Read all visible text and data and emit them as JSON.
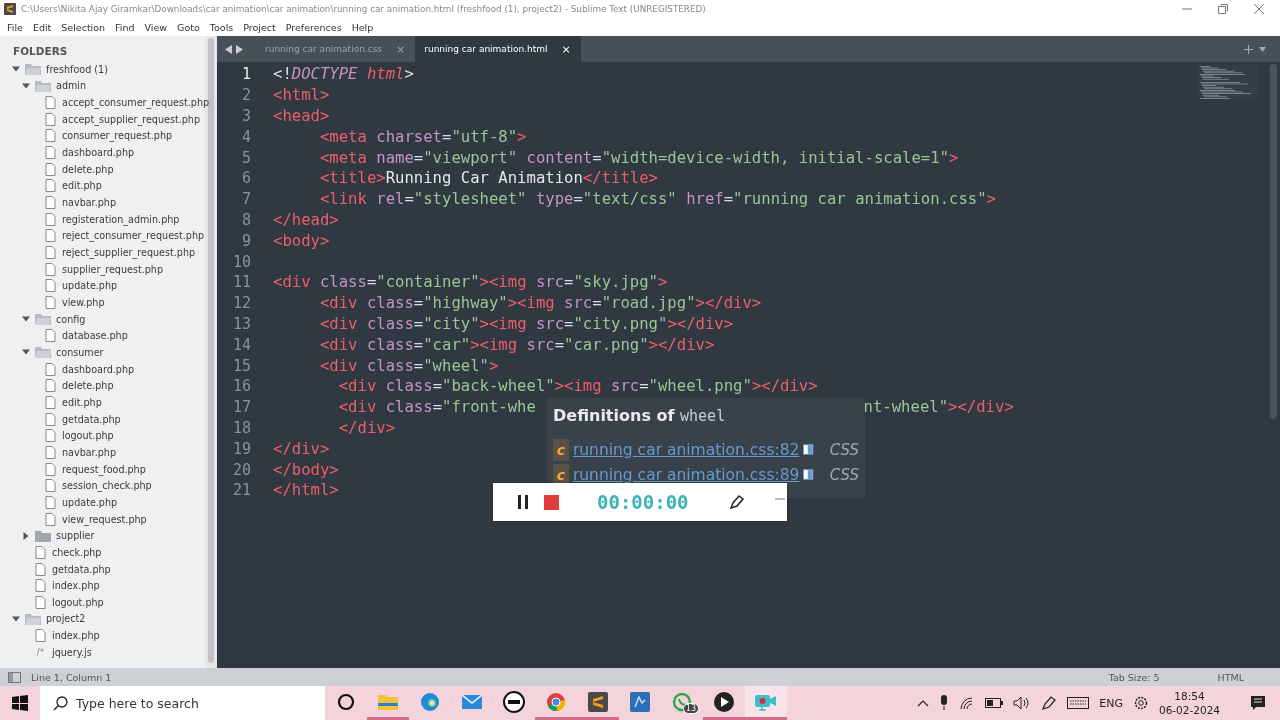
{
  "window": {
    "title": "C:\\Users\\Nikita Ajay Giramkar\\Downloads\\car animation\\car animation\\running car animation.html (freshfood (1), project2) - Sublime Text (UNREGISTERED)"
  },
  "menu": [
    "File",
    "Edit",
    "Selection",
    "Find",
    "View",
    "Goto",
    "Tools",
    "Project",
    "Preferences",
    "Help"
  ],
  "sidebar": {
    "heading": "FOLDERS",
    "tree": [
      {
        "kind": "folder",
        "name": "freshfood (1)",
        "expanded": true,
        "children": [
          {
            "kind": "folder",
            "name": "admin",
            "expanded": true,
            "children": [
              {
                "kind": "file",
                "name": "accept_consumer_request.php"
              },
              {
                "kind": "file",
                "name": "accept_supplier_request.php"
              },
              {
                "kind": "file",
                "name": "consumer_request.php"
              },
              {
                "kind": "file",
                "name": "dashboard.php"
              },
              {
                "kind": "file",
                "name": "delete.php"
              },
              {
                "kind": "file",
                "name": "edit.php"
              },
              {
                "kind": "file",
                "name": "navbar.php"
              },
              {
                "kind": "file",
                "name": "registeration_admin.php"
              },
              {
                "kind": "file",
                "name": "reject_consumer_request.php"
              },
              {
                "kind": "file",
                "name": "reject_supplier_request.php"
              },
              {
                "kind": "file",
                "name": "supplier_request.php"
              },
              {
                "kind": "file",
                "name": "update.php"
              },
              {
                "kind": "file",
                "name": "view.php"
              }
            ]
          },
          {
            "kind": "folder",
            "name": "config",
            "expanded": true,
            "children": [
              {
                "kind": "file",
                "name": "database.php"
              }
            ]
          },
          {
            "kind": "folder",
            "name": "consumer",
            "expanded": true,
            "children": [
              {
                "kind": "file",
                "name": "dashboard.php"
              },
              {
                "kind": "file",
                "name": "delete.php"
              },
              {
                "kind": "file",
                "name": "edit.php"
              },
              {
                "kind": "file",
                "name": "getdata.php"
              },
              {
                "kind": "file",
                "name": "logout.php"
              },
              {
                "kind": "file",
                "name": "navbar.php"
              },
              {
                "kind": "file",
                "name": "request_food.php"
              },
              {
                "kind": "file",
                "name": "session_check.php"
              },
              {
                "kind": "file",
                "name": "update.php"
              },
              {
                "kind": "file",
                "name": "view_request.php"
              }
            ]
          },
          {
            "kind": "folder",
            "name": "supplier",
            "expanded": false
          },
          {
            "kind": "file",
            "name": "check.php"
          },
          {
            "kind": "file",
            "name": "getdata.php"
          },
          {
            "kind": "file",
            "name": "index.php"
          },
          {
            "kind": "file",
            "name": "logout.php"
          }
        ]
      },
      {
        "kind": "folder",
        "name": "project2",
        "expanded": true,
        "children": [
          {
            "kind": "file",
            "name": "index.php"
          },
          {
            "kind": "script",
            "name": "jquery.js",
            "icon_text": "/*"
          }
        ]
      }
    ]
  },
  "tabs": [
    {
      "label": "running car animation.css",
      "selected": false,
      "close": "×"
    },
    {
      "label": "running car animation.html",
      "selected": true,
      "close": "×"
    }
  ],
  "code": {
    "lines": [
      {
        "number": "1",
        "current": true,
        "tokens": [
          {
            "kind": "punct",
            "text": "<!"
          },
          {
            "kind": "keyword",
            "text": "DOCTYPE"
          },
          {
            "kind": "doctype",
            "text": " html"
          },
          {
            "kind": "punct",
            "text": ">"
          }
        ]
      },
      {
        "number": "2",
        "current": false,
        "tokens": [
          {
            "kind": "tag",
            "text": "<html>"
          }
        ]
      },
      {
        "number": "3",
        "current": false,
        "tokens": [
          {
            "kind": "tag",
            "text": "<head>"
          }
        ]
      },
      {
        "number": "4",
        "current": false,
        "tokens": [
          {
            "kind": "tag",
            "text": "     <meta"
          },
          {
            "kind": "attr",
            "text": " charset"
          },
          {
            "kind": "punct",
            "text": "="
          },
          {
            "kind": "string",
            "text": "\"utf-8\""
          },
          {
            "kind": "tag",
            "text": ">"
          }
        ]
      },
      {
        "number": "5",
        "current": false,
        "tokens": [
          {
            "kind": "tag",
            "text": "     <meta"
          },
          {
            "kind": "attr",
            "text": " name"
          },
          {
            "kind": "punct",
            "text": "="
          },
          {
            "kind": "string",
            "text": "\"viewport\""
          },
          {
            "kind": "attr",
            "text": " content"
          },
          {
            "kind": "punct",
            "text": "="
          },
          {
            "kind": "string",
            "text": "\"width=device-width, initial-scale=1\""
          },
          {
            "kind": "tag",
            "text": ">"
          }
        ]
      },
      {
        "number": "6",
        "current": false,
        "tokens": [
          {
            "kind": "tag",
            "text": "     <title>"
          },
          {
            "kind": "text",
            "text": "Running Car Animation"
          },
          {
            "kind": "tag",
            "text": "</title>"
          }
        ]
      },
      {
        "number": "7",
        "current": false,
        "tokens": [
          {
            "kind": "tag",
            "text": "     <link"
          },
          {
            "kind": "attr",
            "text": " rel"
          },
          {
            "kind": "punct",
            "text": "="
          },
          {
            "kind": "string",
            "text": "\"stylesheet\""
          },
          {
            "kind": "attr",
            "text": " type"
          },
          {
            "kind": "punct",
            "text": "="
          },
          {
            "kind": "string",
            "text": "\"text/css\""
          },
          {
            "kind": "attr",
            "text": " href"
          },
          {
            "kind": "punct",
            "text": "="
          },
          {
            "kind": "string",
            "text": "\"running car animation.css\""
          },
          {
            "kind": "tag",
            "text": ">"
          }
        ]
      },
      {
        "number": "8",
        "current": false,
        "tokens": [
          {
            "kind": "tag",
            "text": "</head>"
          }
        ]
      },
      {
        "number": "9",
        "current": false,
        "tokens": [
          {
            "kind": "tag",
            "text": "<body>"
          }
        ]
      },
      {
        "number": "10",
        "current": false
      },
      {
        "number": "11",
        "current": false,
        "tokens": [
          {
            "kind": "tag",
            "text": "<div"
          },
          {
            "kind": "attr",
            "text": " class"
          },
          {
            "kind": "punct",
            "text": "="
          },
          {
            "kind": "string",
            "text": "\"container\""
          },
          {
            "kind": "tag",
            "text": "><img"
          },
          {
            "kind": "attr",
            "text": " src"
          },
          {
            "kind": "punct",
            "text": "="
          },
          {
            "kind": "string",
            "text": "\"sky.jpg\""
          },
          {
            "kind": "tag",
            "text": ">"
          }
        ]
      },
      {
        "number": "12",
        "current": false,
        "tokens": [
          {
            "kind": "tag",
            "text": "     <div"
          },
          {
            "kind": "attr",
            "text": " class"
          },
          {
            "kind": "punct",
            "text": "="
          },
          {
            "kind": "string",
            "text": "\"highway\""
          },
          {
            "kind": "tag",
            "text": "><img"
          },
          {
            "kind": "attr",
            "text": " src"
          },
          {
            "kind": "punct",
            "text": "="
          },
          {
            "kind": "string",
            "text": "\"road.jpg\""
          },
          {
            "kind": "tag",
            "text": "></div>"
          }
        ]
      },
      {
        "number": "13",
        "current": false,
        "tokens": [
          {
            "kind": "tag",
            "text": "     <div"
          },
          {
            "kind": "attr",
            "text": " class"
          },
          {
            "kind": "punct",
            "text": "="
          },
          {
            "kind": "string",
            "text": "\"city\""
          },
          {
            "kind": "tag",
            "text": "><img"
          },
          {
            "kind": "attr",
            "text": " src"
          },
          {
            "kind": "punct",
            "text": "="
          },
          {
            "kind": "string",
            "text": "\"city.png\""
          },
          {
            "kind": "tag",
            "text": "></div>"
          }
        ]
      },
      {
        "number": "14",
        "current": false,
        "tokens": [
          {
            "kind": "tag",
            "text": "     <div"
          },
          {
            "kind": "attr",
            "text": " class"
          },
          {
            "kind": "punct",
            "text": "="
          },
          {
            "kind": "string",
            "text": "\"car\""
          },
          {
            "kind": "tag",
            "text": "><img"
          },
          {
            "kind": "attr",
            "text": " src"
          },
          {
            "kind": "punct",
            "text": "="
          },
          {
            "kind": "string",
            "text": "\"car.png\""
          },
          {
            "kind": "tag",
            "text": "></div>"
          }
        ]
      },
      {
        "number": "15",
        "current": false,
        "tokens": [
          {
            "kind": "tag",
            "text": "     <div"
          },
          {
            "kind": "attr",
            "text": " class"
          },
          {
            "kind": "punct",
            "text": "="
          },
          {
            "kind": "string",
            "text": "\"wheel\""
          },
          {
            "kind": "tag",
            "text": ">"
          }
        ]
      },
      {
        "number": "16",
        "current": false,
        "tokens": [
          {
            "kind": "tag",
            "text": "       <div"
          },
          {
            "kind": "attr",
            "text": " class"
          },
          {
            "kind": "punct",
            "text": "="
          },
          {
            "kind": "string",
            "text": "\"back-wheel\""
          },
          {
            "kind": "tag",
            "text": "><img"
          },
          {
            "kind": "attr",
            "text": " src"
          },
          {
            "kind": "punct",
            "text": "="
          },
          {
            "kind": "string",
            "text": "\"wheel.png\""
          },
          {
            "kind": "tag",
            "text": "></div>"
          }
        ]
      },
      {
        "number": "17",
        "current": false,
        "tokens": [
          {
            "kind": "tag",
            "text": "       <div"
          },
          {
            "kind": "attr",
            "text": " class"
          },
          {
            "kind": "punct",
            "text": "="
          },
          {
            "kind": "string",
            "text": "\"front-whe"
          }
        ],
        "tail": [
          {
            "kind": "string",
            "text": "nt-wheel\""
          },
          {
            "kind": "tag",
            "text": "></div>"
          }
        ]
      },
      {
        "number": "18",
        "current": false,
        "tokens": [
          {
            "kind": "tag",
            "text": "       </div>"
          }
        ]
      },
      {
        "number": "19",
        "current": false,
        "tokens": [
          {
            "kind": "tag",
            "text": "</div>"
          }
        ]
      },
      {
        "number": "20",
        "current": false,
        "tokens": [
          {
            "kind": "tag",
            "text": "</body>"
          }
        ]
      },
      {
        "number": "21",
        "current": false,
        "tokens": [
          {
            "kind": "tag",
            "text": "</html>"
          }
        ]
      }
    ]
  },
  "definitions_popup": {
    "title": "Definitions of",
    "symbol": "wheel",
    "items": [
      {
        "badge": "c",
        "link": "running car animation.css:82",
        "syntax": "CSS"
      },
      {
        "badge": "c",
        "link": "running car animation.css:89",
        "syntax": "CSS"
      }
    ]
  },
  "recorder": {
    "time": "00:00:00"
  },
  "status_bar": {
    "position": "Line 1, Column 1",
    "tab_size": "Tab Size: 5",
    "syntax": "HTML"
  },
  "taskbar": {
    "search_placeholder": "Type here to search",
    "apps": [
      {
        "kind": "cortana",
        "running": false,
        "active": false
      },
      {
        "kind": "explorer",
        "running": true,
        "active": false
      },
      {
        "kind": "edge",
        "running": false,
        "active": false
      },
      {
        "kind": "mail",
        "running": false,
        "active": false
      },
      {
        "kind": "dell",
        "running": false,
        "active": false
      },
      {
        "kind": "chrome",
        "running": true,
        "active": false
      },
      {
        "kind": "sublime",
        "running": true,
        "active": false
      },
      {
        "kind": "blueapp",
        "running": false,
        "active": false
      },
      {
        "kind": "whatsapp",
        "running": false,
        "active": false,
        "badge": "13"
      },
      {
        "kind": "player",
        "running": true,
        "active": false
      },
      {
        "kind": "recorder",
        "running": true,
        "active": true
      }
    ],
    "language": "ENG",
    "time": "18:54",
    "date": "06-02-2024"
  }
}
